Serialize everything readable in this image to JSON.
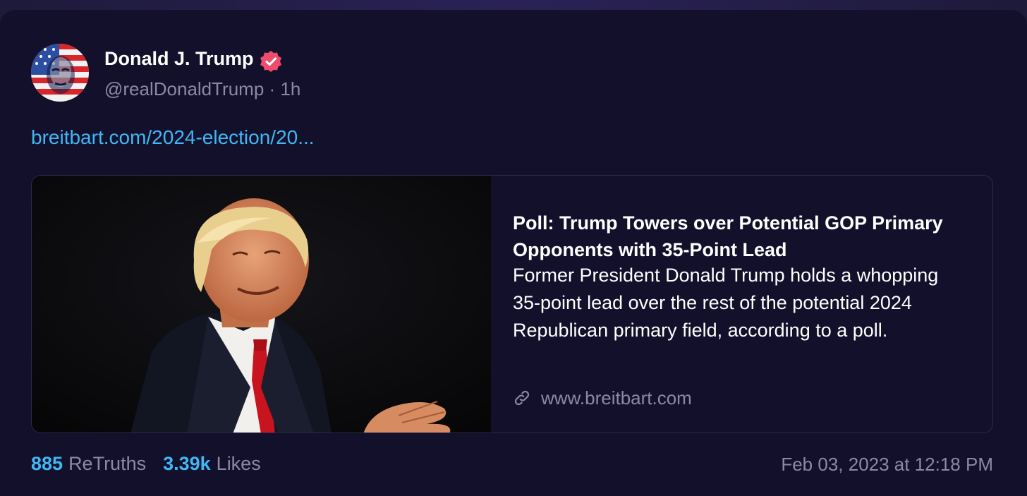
{
  "post": {
    "author": {
      "display_name": "Donald J. Trump",
      "handle": "@realDonaldTrump",
      "separator": "·",
      "relative_time": "1h",
      "verified": true,
      "avatar_icon": "avatar-flag-portrait-icon"
    },
    "link_text": "breitbart.com/2024-election/20...",
    "preview": {
      "title": "Poll: Trump Towers over Potential GOP Primary Opponents with 35-Point Lead",
      "description": "Former President Donald Trump holds a whopping 35-point lead over the rest of the potential 2024 Republican primary field, according to a poll.",
      "domain": "www.breitbart.com",
      "domain_icon": "link-icon"
    },
    "stats": {
      "retruths_count": "885",
      "retruths_label": "ReTruths",
      "likes_count": "3.39k",
      "likes_label": "Likes"
    },
    "timestamp": "Feb 03, 2023 at 12:18 PM"
  },
  "colors": {
    "background": "#13102c",
    "accent": "#3fb8f4",
    "verified_badge": "#ef4b6d",
    "muted_text": "#8b8aa6"
  }
}
